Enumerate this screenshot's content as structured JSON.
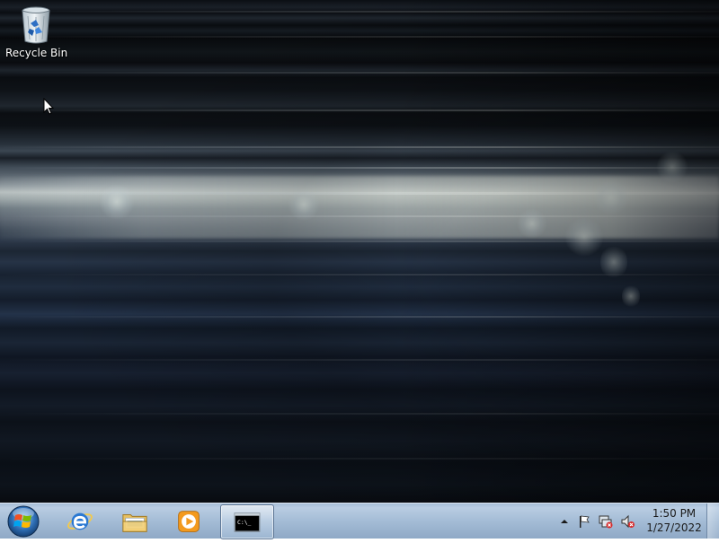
{
  "desktop": {
    "icons": [
      {
        "label": "Recycle Bin",
        "icon": "recycle-bin-icon"
      }
    ]
  },
  "taskbar": {
    "start_icon": "windows-logo-icon",
    "pinned": [
      {
        "name": "Internet Explorer",
        "icon": "internet-explorer-icon"
      },
      {
        "name": "Windows Explorer",
        "icon": "folder-icon"
      },
      {
        "name": "Windows Media Player",
        "icon": "media-player-icon"
      },
      {
        "name": "Command Prompt",
        "icon": "command-prompt-icon",
        "active": true,
        "glyph": "C:\\_"
      }
    ],
    "tray": {
      "icons": [
        "show-hidden-icons-icon",
        "action-center-flag-icon",
        "network-icon",
        "volume-muted-icon"
      ]
    },
    "clock": {
      "time": "1:50 PM",
      "date": "1/27/2022"
    }
  },
  "colors": {
    "taskbar": "#a7bfd8",
    "clock_text": "#1a1a1a"
  }
}
